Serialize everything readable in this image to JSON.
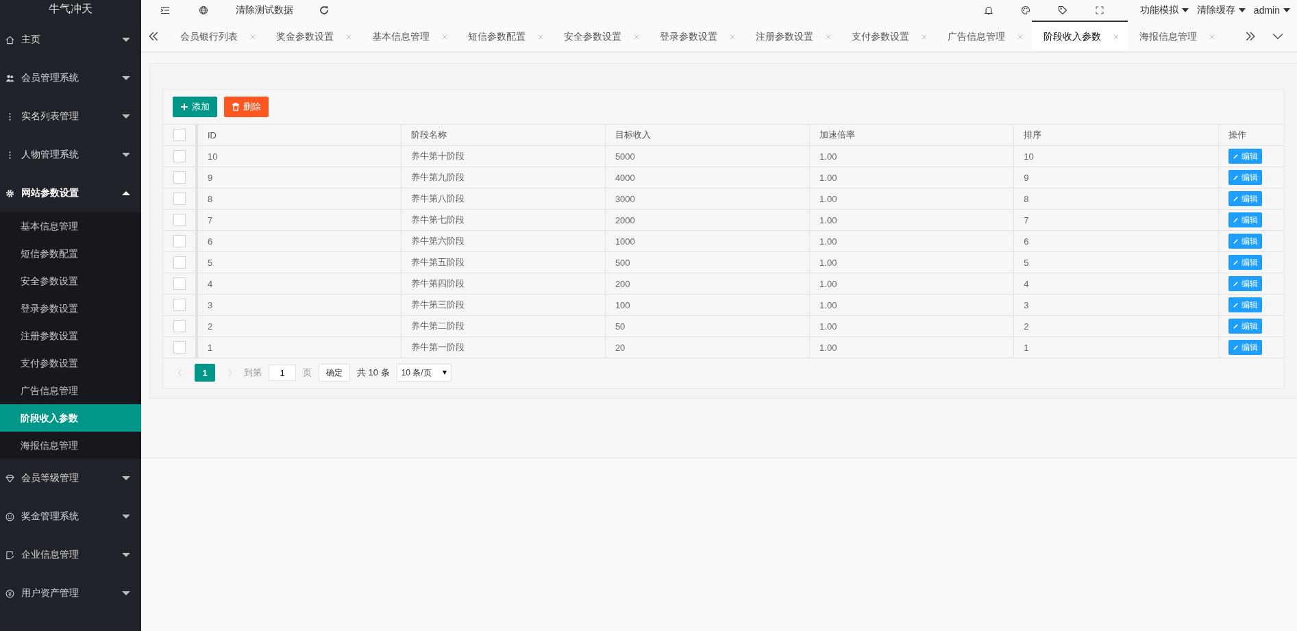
{
  "sidebar": {
    "logo": "牛气冲天",
    "items": [
      {
        "label": "主页",
        "expanded": false
      },
      {
        "label": "会员管理系统",
        "expanded": false
      },
      {
        "label": "实名列表管理",
        "expanded": false
      },
      {
        "label": "人物管理系统",
        "expanded": false
      },
      {
        "label": "网站参数设置",
        "expanded": true,
        "children": [
          {
            "label": "基本信息管理",
            "selected": false
          },
          {
            "label": "短信参数配置",
            "selected": false
          },
          {
            "label": "安全参数设置",
            "selected": false
          },
          {
            "label": "登录参数设置",
            "selected": false
          },
          {
            "label": "注册参数设置",
            "selected": false
          },
          {
            "label": "支付参数设置",
            "selected": false
          },
          {
            "label": "广告信息管理",
            "selected": false
          },
          {
            "label": "阶段收入参数",
            "selected": true
          },
          {
            "label": "海报信息管理",
            "selected": false
          }
        ]
      },
      {
        "label": "会员等级管理",
        "expanded": false
      },
      {
        "label": "奖金管理系统",
        "expanded": false
      },
      {
        "label": "企业信息管理",
        "expanded": false
      },
      {
        "label": "用户资产管理",
        "expanded": false
      }
    ]
  },
  "header": {
    "clear_data": "清除测试数据",
    "menus": [
      "功能模拟",
      "清除缓存",
      "admin"
    ]
  },
  "tabs": [
    {
      "label": "会员银行列表",
      "selected": false
    },
    {
      "label": "奖金参数设置",
      "selected": false
    },
    {
      "label": "基本信息管理",
      "selected": false
    },
    {
      "label": "短信参数配置",
      "selected": false
    },
    {
      "label": "安全参数设置",
      "selected": false
    },
    {
      "label": "登录参数设置",
      "selected": false
    },
    {
      "label": "注册参数设置",
      "selected": false
    },
    {
      "label": "支付参数设置",
      "selected": false
    },
    {
      "label": "广告信息管理",
      "selected": false
    },
    {
      "label": "阶段收入参数",
      "selected": true
    },
    {
      "label": "海报信息管理",
      "selected": false
    }
  ],
  "toolbar": [
    {
      "kind": "add",
      "label": "添加"
    },
    {
      "kind": "delete",
      "label": "删除"
    }
  ],
  "table": {
    "header_checked": false,
    "columns": [
      "ID",
      "阶段名称",
      "目标收入",
      "加速倍率",
      "排序",
      "操作"
    ],
    "rows": [
      {
        "checked": false,
        "cells": [
          "10",
          "养牛第十阶段",
          "5000",
          "1.00",
          "10"
        ],
        "action": "编辑"
      },
      {
        "checked": false,
        "cells": [
          "9",
          "养牛第九阶段",
          "4000",
          "1.00",
          "9"
        ],
        "action": "编辑"
      },
      {
        "checked": false,
        "cells": [
          "8",
          "养牛第八阶段",
          "3000",
          "1.00",
          "8"
        ],
        "action": "编辑"
      },
      {
        "checked": false,
        "cells": [
          "7",
          "养牛第七阶段",
          "2000",
          "1.00",
          "7"
        ],
        "action": "编辑"
      },
      {
        "checked": false,
        "cells": [
          "6",
          "养牛第六阶段",
          "1000",
          "1.00",
          "6"
        ],
        "action": "编辑"
      },
      {
        "checked": false,
        "cells": [
          "5",
          "养牛第五阶段",
          "500",
          "1.00",
          "5"
        ],
        "action": "编辑"
      },
      {
        "checked": false,
        "cells": [
          "4",
          "养牛第四阶段",
          "200",
          "1.00",
          "4"
        ],
        "action": "编辑"
      },
      {
        "checked": false,
        "cells": [
          "3",
          "养牛第三阶段",
          "100",
          "1.00",
          "3"
        ],
        "action": "编辑"
      },
      {
        "checked": false,
        "cells": [
          "2",
          "养牛第二阶段",
          "50",
          "1.00",
          "2"
        ],
        "action": "编辑"
      },
      {
        "checked": false,
        "cells": [
          "1",
          "养牛第一阶段",
          "20",
          "1.00",
          "1"
        ],
        "action": "编辑"
      }
    ]
  },
  "pagination": {
    "pages": [
      {
        "label": "1",
        "selected": true
      }
    ],
    "goto_label": "到第",
    "page_value": "1",
    "page_unit": "页",
    "confirm": "确定",
    "total": "共 10 条",
    "page_size": "10 条/页"
  }
}
